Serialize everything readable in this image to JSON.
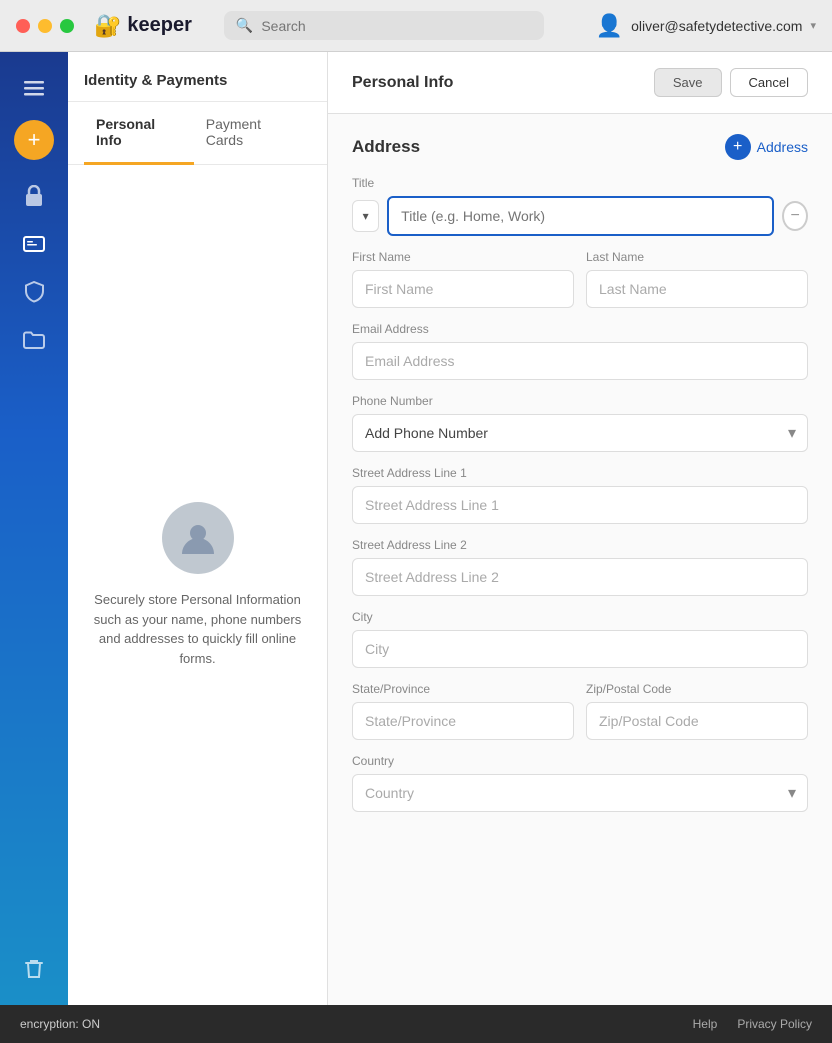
{
  "titlebar": {
    "search_placeholder": "Search",
    "user_email": "oliver@safetydetective.com"
  },
  "logo": {
    "text": "keeper"
  },
  "sidebar_icons": {
    "menu": "☰",
    "add": "+",
    "lock": "🔒",
    "card": "🪪",
    "shield": "🛡",
    "folder": "🗂",
    "trash": "🗑"
  },
  "middle_panel": {
    "header": "Identity & Payments",
    "tabs": [
      {
        "id": "personal",
        "label": "Personal Info",
        "active": true
      },
      {
        "id": "payment",
        "label": "Payment Cards",
        "active": false
      }
    ],
    "description": "Securely store Personal Information such as your name, phone numbers and addresses to quickly fill online forms."
  },
  "right_panel": {
    "title": "Personal Info",
    "save_label": "Save",
    "cancel_label": "Cancel",
    "section_title": "Address",
    "add_address_label": "Address",
    "fields": {
      "title_label": "Title",
      "title_placeholder": "Title (e.g. Home, Work)",
      "first_name_label": "First Name",
      "first_name_placeholder": "First Name",
      "last_name_label": "Last Name",
      "last_name_placeholder": "Last Name",
      "email_label": "Email Address",
      "email_placeholder": "Email Address",
      "phone_label": "Phone Number",
      "phone_placeholder": "Add Phone Number",
      "street1_label": "Street Address Line 1",
      "street1_placeholder": "Street Address Line 1",
      "street2_label": "Street Address Line 2",
      "street2_placeholder": "Street Address Line 2",
      "city_label": "City",
      "city_placeholder": "City",
      "state_label": "State/Province",
      "state_placeholder": "State/Province",
      "zip_label": "Zip/Postal Code",
      "zip_placeholder": "Zip/Postal Code",
      "country_label": "Country",
      "country_placeholder": "Country"
    }
  },
  "footer": {
    "encryption_text": "encryption: ON",
    "help_label": "Help",
    "privacy_label": "Privacy Policy"
  }
}
